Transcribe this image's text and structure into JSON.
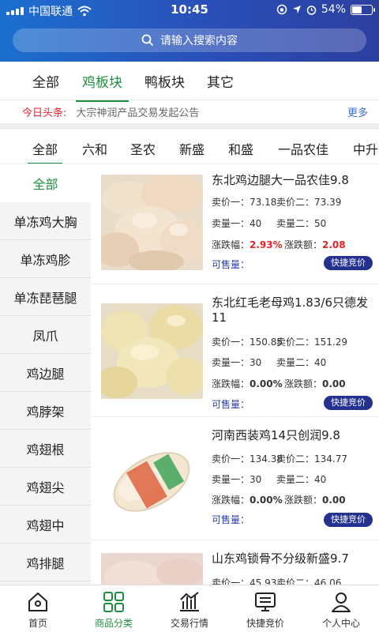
{
  "status_bar": {
    "carrier": "中国联通",
    "time": "10:45",
    "battery": "54%",
    "battery_level": 0.54
  },
  "search": {
    "placeholder": "请输入搜索内容"
  },
  "category_tabs": [
    {
      "label": "全部",
      "active": false
    },
    {
      "label": "鸡板块",
      "active": true
    },
    {
      "label": "鸭板块",
      "active": false
    },
    {
      "label": "其它",
      "active": false
    }
  ],
  "news": {
    "tag": "今日头条:",
    "text": "大宗神润产品交易发起公告",
    "more": "更多"
  },
  "sub_tabs": [
    {
      "label": "全部",
      "active": true
    },
    {
      "label": "六和",
      "active": false
    },
    {
      "label": "圣农",
      "active": false
    },
    {
      "label": "新盛",
      "active": false
    },
    {
      "label": "和盛",
      "active": false
    },
    {
      "label": "一品农佳",
      "active": false
    },
    {
      "label": "中升",
      "active": false
    }
  ],
  "sidebar": [
    {
      "label": "全部",
      "active": true
    },
    {
      "label": "单冻鸡大胸",
      "active": false
    },
    {
      "label": "单冻鸡胗",
      "active": false
    },
    {
      "label": "单冻琵琶腿",
      "active": false
    },
    {
      "label": "凤爪",
      "active": false
    },
    {
      "label": "鸡边腿",
      "active": false
    },
    {
      "label": "鸡脖架",
      "active": false
    },
    {
      "label": "鸡翅根",
      "active": false
    },
    {
      "label": "鸡翅尖",
      "active": false
    },
    {
      "label": "鸡翅中",
      "active": false
    },
    {
      "label": "鸡排腿",
      "active": false
    }
  ],
  "labels": {
    "sell1": "卖价一：",
    "sell2": "卖价二：",
    "qty1": "卖量一：",
    "qty2": "卖量二：",
    "change_pct": "涨跌幅：",
    "change_amt": "涨跌额：",
    "sellable": "可售量：",
    "quick_bid": "快捷竞价"
  },
  "products": [
    {
      "title": "东北鸡边腿大一品农佳9.8",
      "sell1": "73.18",
      "sell2": "73.39",
      "qty1": "40",
      "qty2": "50",
      "change_pct": "2.93%",
      "change_amt": "2.08",
      "image": "chicken-leg-image"
    },
    {
      "title": "东北红毛老母鸡1.83/6只德发11",
      "sell1": "150.85",
      "sell2": "151.29",
      "qty1": "30",
      "qty2": "40",
      "change_pct": "0.00%",
      "change_amt": "0.00",
      "image": "whole-chicken-image"
    },
    {
      "title": "河南西装鸡14只创润9.8",
      "sell1": "134.38",
      "sell2": "134.77",
      "qty1": "30",
      "qty2": "40",
      "change_pct": "0.00%",
      "change_amt": "0.00",
      "image": "packaged-chicken-image"
    },
    {
      "title": "山东鸡锁骨不分级新盛9.7",
      "sell1": "45.93",
      "sell2": "46.06",
      "qty1": "",
      "qty2": "",
      "change_pct": "",
      "change_amt": "",
      "image": "chicken-bone-image"
    }
  ],
  "bottom_nav": [
    {
      "label": "首页",
      "icon": "home-icon",
      "active": false
    },
    {
      "label": "商品分类",
      "icon": "grid-icon",
      "active": true
    },
    {
      "label": "交易行情",
      "icon": "chart-icon",
      "active": false
    },
    {
      "label": "快捷竞价",
      "icon": "monitor-icon",
      "active": false
    },
    {
      "label": "个人中心",
      "icon": "person-icon",
      "active": false
    }
  ],
  "colors": {
    "header_start": "#1b6fd0",
    "header_end": "#2c3f9f",
    "accent_green": "#1e8e3e",
    "red": "#e32222",
    "button_navy": "#24318f"
  }
}
